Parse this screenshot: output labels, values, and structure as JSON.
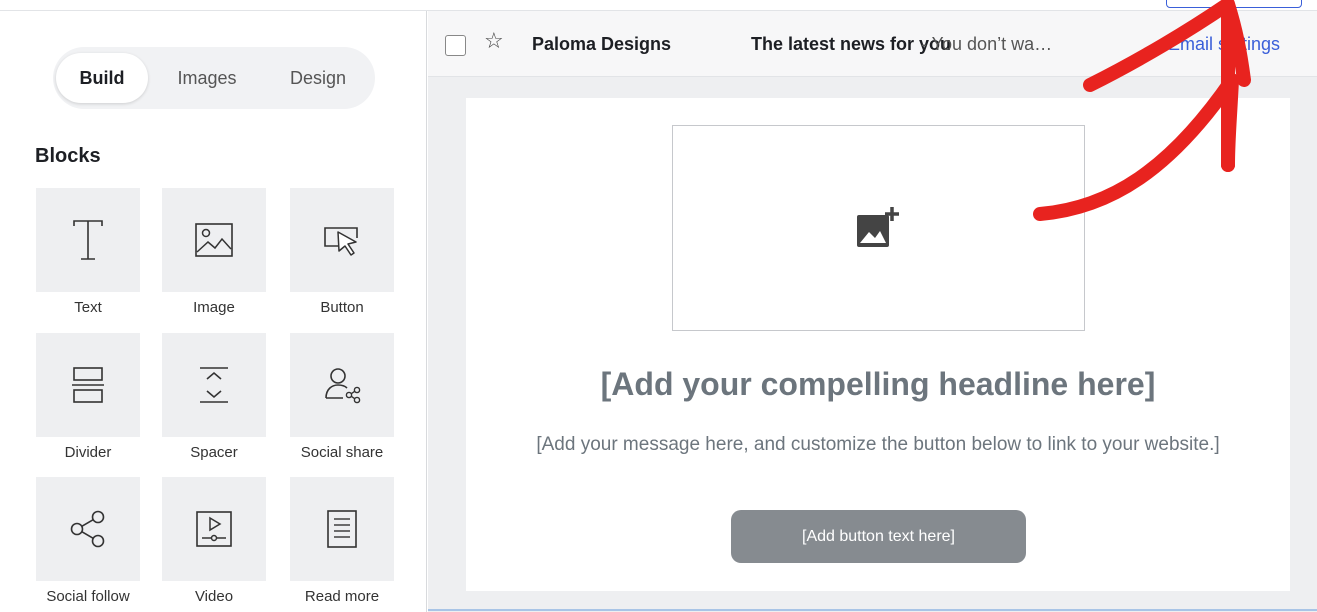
{
  "sidebar": {
    "tabs": [
      {
        "label": "Build",
        "active": true
      },
      {
        "label": "Images",
        "active": false
      },
      {
        "label": "Design",
        "active": false
      }
    ],
    "blocks_title": "Blocks",
    "blocks": [
      {
        "label": "Text",
        "icon": "text-icon"
      },
      {
        "label": "Image",
        "icon": "image-icon"
      },
      {
        "label": "Button",
        "icon": "button-cursor-icon"
      },
      {
        "label": "Divider",
        "icon": "divider-icon"
      },
      {
        "label": "Spacer",
        "icon": "spacer-icon"
      },
      {
        "label": "Social share",
        "icon": "social-share-icon"
      },
      {
        "label": "Social follow",
        "icon": "share-nodes-icon"
      },
      {
        "label": "Video",
        "icon": "video-icon"
      },
      {
        "label": "Read more",
        "icon": "document-icon"
      }
    ]
  },
  "inbox_header": {
    "sender": "Paloma Designs",
    "subject": "The latest news for you",
    "preheader": "- You don’t wa…",
    "settings_link": "Email settings"
  },
  "email": {
    "image_placeholder_icon": "add-image-icon",
    "headline": "[Add your compelling headline here]",
    "message": "[Add your message here, and customize the button below to link to your website.]",
    "button_label": "[Add button text here]"
  },
  "colors": {
    "accent_blue": "#3a5fd9",
    "annotation_red": "#e8231f",
    "placeholder_gray": "#6c757d",
    "button_gray": "#868b90"
  }
}
